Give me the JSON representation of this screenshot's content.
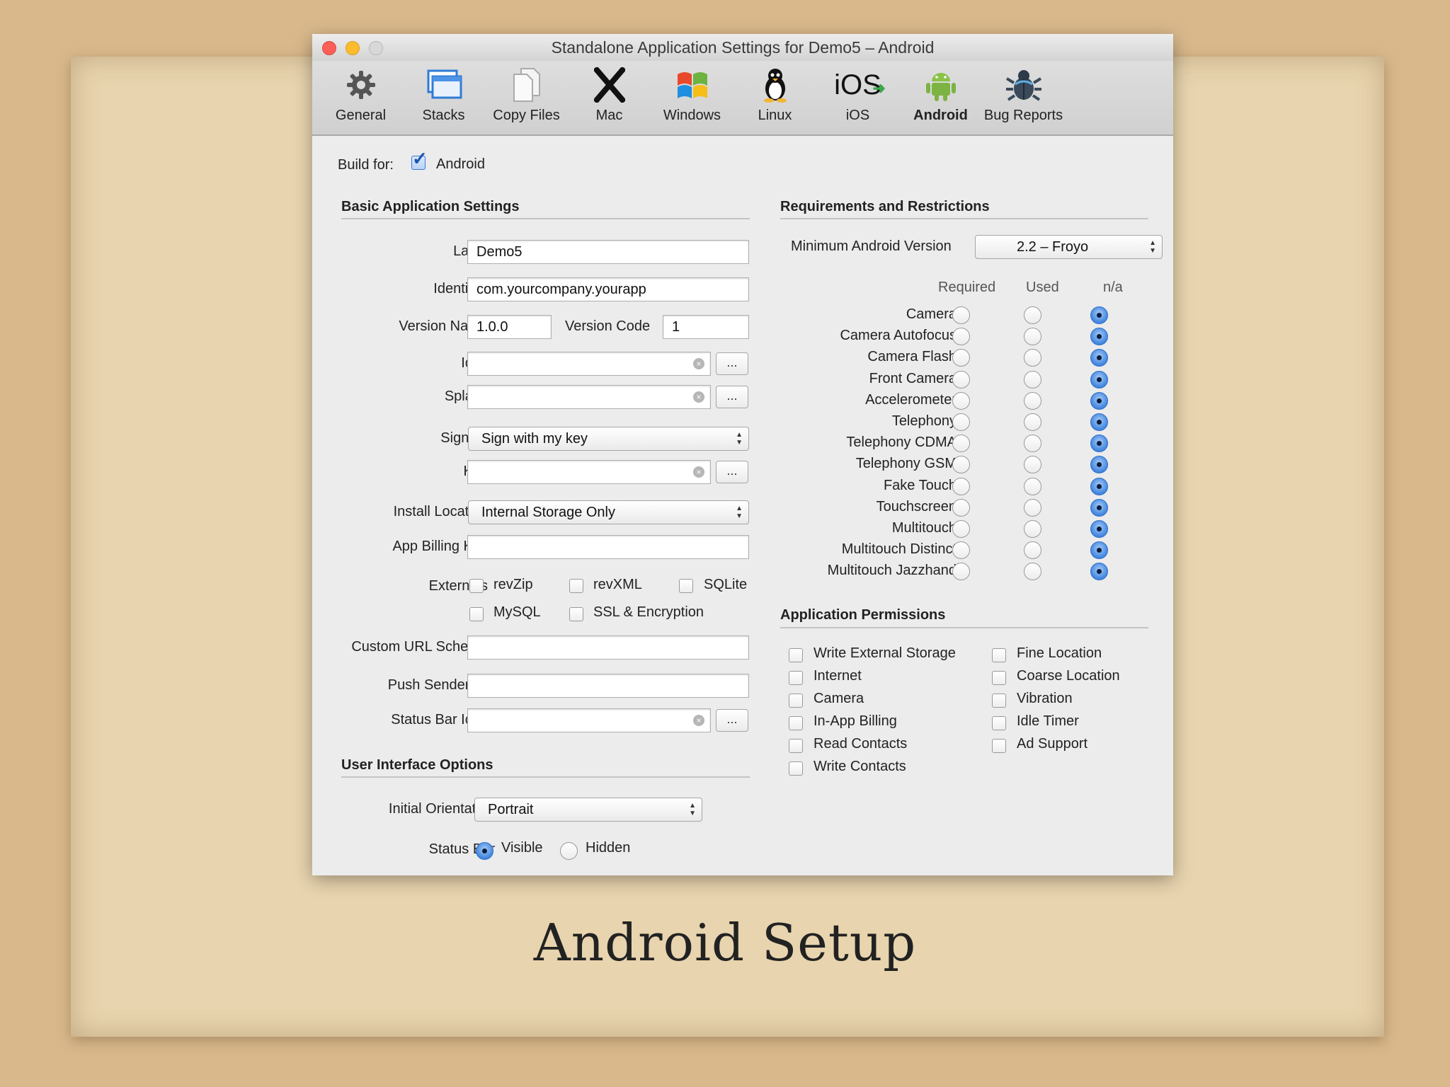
{
  "window": {
    "title": "Standalone Application Settings for Demo5 – Android"
  },
  "toolbar": {
    "tabs": [
      {
        "label": "General",
        "icon": "gear-icon"
      },
      {
        "label": "Stacks",
        "icon": "stacks-icon"
      },
      {
        "label": "Copy Files",
        "icon": "copy-files-icon"
      },
      {
        "label": "Mac",
        "icon": "mac-x-icon"
      },
      {
        "label": "Windows",
        "icon": "windows-icon"
      },
      {
        "label": "Linux",
        "icon": "linux-penguin-icon"
      },
      {
        "label": "iOS",
        "icon": "ios-icon"
      },
      {
        "label": "Android",
        "icon": "android-icon"
      },
      {
        "label": "Bug Reports",
        "icon": "bug-icon"
      }
    ],
    "active": "Android",
    "ios_icon_text": "iOS"
  },
  "build_for": {
    "label": "Build for:",
    "option": "Android",
    "checked": true
  },
  "basic": {
    "title": "Basic Application Settings",
    "label_label": "Label",
    "label_value": "Demo5",
    "identifier_label": "Identifier",
    "identifier_value": "com.yourcompany.yourapp",
    "version_name_label": "Version Name",
    "version_name_value": "1.0.0",
    "version_code_label": "Version Code",
    "version_code_value": "1",
    "icon_label": "Icon",
    "splash_label": "Splash",
    "signing_label": "Signing",
    "signing_value": "Sign with my key",
    "key_label": "Key",
    "install_location_label": "Install Location",
    "install_location_value": "Internal Storage Only",
    "app_billing_key_label": "App Billing Key",
    "externals_label": "Externals",
    "externals": [
      "revZip",
      "revXML",
      "SQLite",
      "MySQL",
      "SSL & Encryption"
    ],
    "custom_url_label": "Custom URL Scheme",
    "push_sender_label": "Push Sender ID",
    "status_bar_icon_label": "Status Bar Icon",
    "browse": "..."
  },
  "ui_options": {
    "title": "User Interface Options",
    "orientation_label": "Initial Orientation",
    "orientation_value": "Portrait",
    "status_bar_label": "Status Bar",
    "visible": "Visible",
    "hidden": "Hidden",
    "selected": "Visible"
  },
  "requirements": {
    "title": "Requirements and Restrictions",
    "min_version_label": "Minimum Android Version",
    "min_version_value": "2.2 – Froyo",
    "columns": [
      "Required",
      "Used",
      "n/a"
    ],
    "rows": [
      "Camera",
      "Camera Autofocus",
      "Camera Flash",
      "Front Camera",
      "Accelerometer",
      "Telephony",
      "Telephony CDMA",
      "Telephony GSM",
      "Fake Touch",
      "Touchscreen",
      "Multitouch",
      "Multitouch Distinct",
      "Multitouch Jazzhand"
    ],
    "selected_column": "n/a"
  },
  "permissions": {
    "title": "Application Permissions",
    "left": [
      "Write External Storage",
      "Internet",
      "Camera",
      "In-App Billing",
      "Read Contacts",
      "Write Contacts"
    ],
    "right": [
      "Fine Location",
      "Coarse Location",
      "Vibration",
      "Idle Timer",
      "Ad Support"
    ]
  },
  "slide": {
    "title": "Android Setup"
  }
}
